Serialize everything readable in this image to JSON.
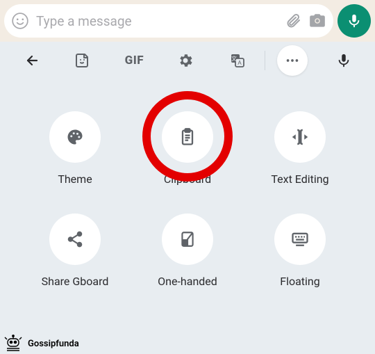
{
  "chat": {
    "placeholder": "Type a message"
  },
  "toolbar": {
    "gif_label": "GIF"
  },
  "options": {
    "theme": "Theme",
    "clipboard": "Clipboard",
    "text_editing": "Text Editing",
    "share_gboard": "Share Gboard",
    "one_handed": "One-handed",
    "floating": "Floating"
  },
  "watermark": {
    "text": "Gossipfunda"
  },
  "colors": {
    "accent": "#0b8f72",
    "highlight": "#e30000",
    "panel_bg": "#e8edf1",
    "icon_fg": "#5f6368"
  }
}
